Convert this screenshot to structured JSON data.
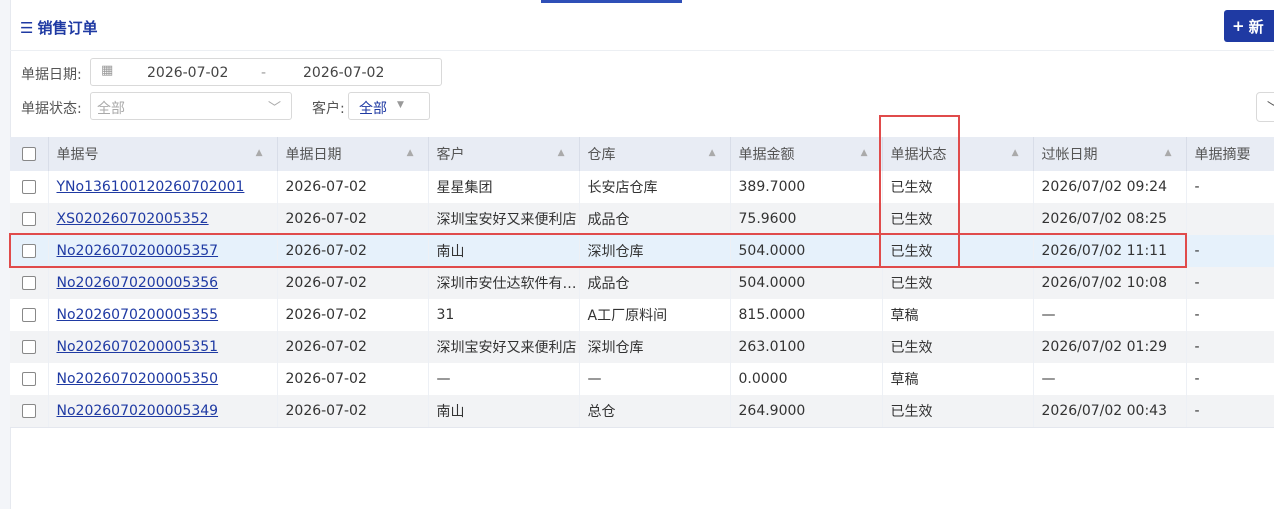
{
  "page": {
    "title": "销售订单",
    "new_button": "新"
  },
  "filters": {
    "date_label": "单据日期:",
    "date_from": "2026-07-02",
    "date_sep": "-",
    "date_to": "2026-07-02",
    "status_label": "单据状态:",
    "status_placeholder": "全部",
    "customer_label": "客户:",
    "customer_value": "全部"
  },
  "table": {
    "columns": [
      "单据号",
      "单据日期",
      "客户",
      "仓库",
      "单据金额",
      "单据状态",
      "过帐日期",
      "单据摘要"
    ],
    "rows": [
      {
        "no": "YNo136100120260702001",
        "date": "2026-07-02",
        "customer": "星星集团",
        "warehouse": "长安店仓库",
        "amount": "389.7000",
        "status": "已生效",
        "post_date": "2026/07/02 09:24",
        "memo": "-"
      },
      {
        "no": "XS020260702005352",
        "date": "2026-07-02",
        "customer": "深圳宝安好又来便利店",
        "warehouse": "成品仓",
        "amount": "75.9600",
        "status": "已生效",
        "post_date": "2026/07/02 08:25",
        "memo": ""
      },
      {
        "no": "No2026070200005357",
        "date": "2026-07-02",
        "customer": "南山",
        "warehouse": "深圳仓库",
        "amount": "504.0000",
        "status": "已生效",
        "post_date": "2026/07/02 11:11",
        "memo": "-"
      },
      {
        "no": "No2026070200005356",
        "date": "2026-07-02",
        "customer": "深圳市安仕达软件有限公司",
        "warehouse": "成品仓",
        "amount": "504.0000",
        "status": "已生效",
        "post_date": "2026/07/02 10:08",
        "memo": "-"
      },
      {
        "no": "No2026070200005355",
        "date": "2026-07-02",
        "customer": "31",
        "warehouse": "A工厂原料间",
        "amount": "815.0000",
        "status": "草稿",
        "post_date": "—",
        "memo": "-"
      },
      {
        "no": "No2026070200005351",
        "date": "2026-07-02",
        "customer": "深圳宝安好又来便利店",
        "warehouse": "深圳仓库",
        "amount": "263.0100",
        "status": "已生效",
        "post_date": "2026/07/02 01:29",
        "memo": "-"
      },
      {
        "no": "No2026070200005350",
        "date": "2026-07-02",
        "customer": "—",
        "warehouse": "—",
        "amount": "0.0000",
        "status": "草稿",
        "post_date": "—",
        "memo": "-"
      },
      {
        "no": "No2026070200005349",
        "date": "2026-07-02",
        "customer": "南山",
        "warehouse": "总仓",
        "amount": "264.9000",
        "status": "已生效",
        "post_date": "2026/07/02 00:43",
        "memo": "-"
      }
    ]
  },
  "colors": {
    "accent": "#1f3aa3",
    "highlight_border": "#e04b4b",
    "selected_row": "#e6f1fb"
  }
}
